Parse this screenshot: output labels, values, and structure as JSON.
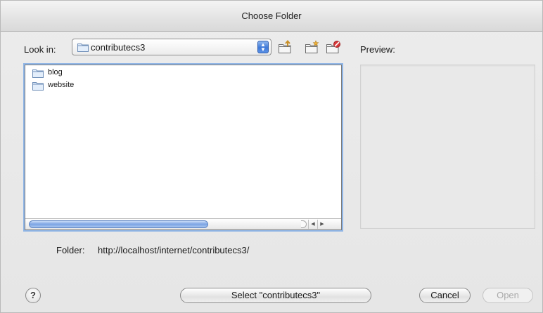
{
  "window": {
    "title": "Choose Folder"
  },
  "look_in": {
    "label": "Look in:",
    "value": "contributecs3",
    "icon": "folder-icon"
  },
  "toolbar": {
    "icons": [
      "folder-up-icon",
      "new-folder-icon",
      "delete-folder-icon"
    ]
  },
  "preview": {
    "label": "Preview:"
  },
  "files": [
    {
      "name": "blog",
      "icon": "folder-icon"
    },
    {
      "name": "website",
      "icon": "folder-icon"
    }
  ],
  "folder": {
    "label": "Folder:",
    "path": "http://localhost/internet/contributecs3/"
  },
  "buttons": {
    "help": "?",
    "select": "Select \"contributecs3\"",
    "cancel": "Cancel",
    "open": "Open"
  },
  "colors": {
    "accent": "#3e79d8",
    "disabled_text": "#a9a9a9"
  }
}
